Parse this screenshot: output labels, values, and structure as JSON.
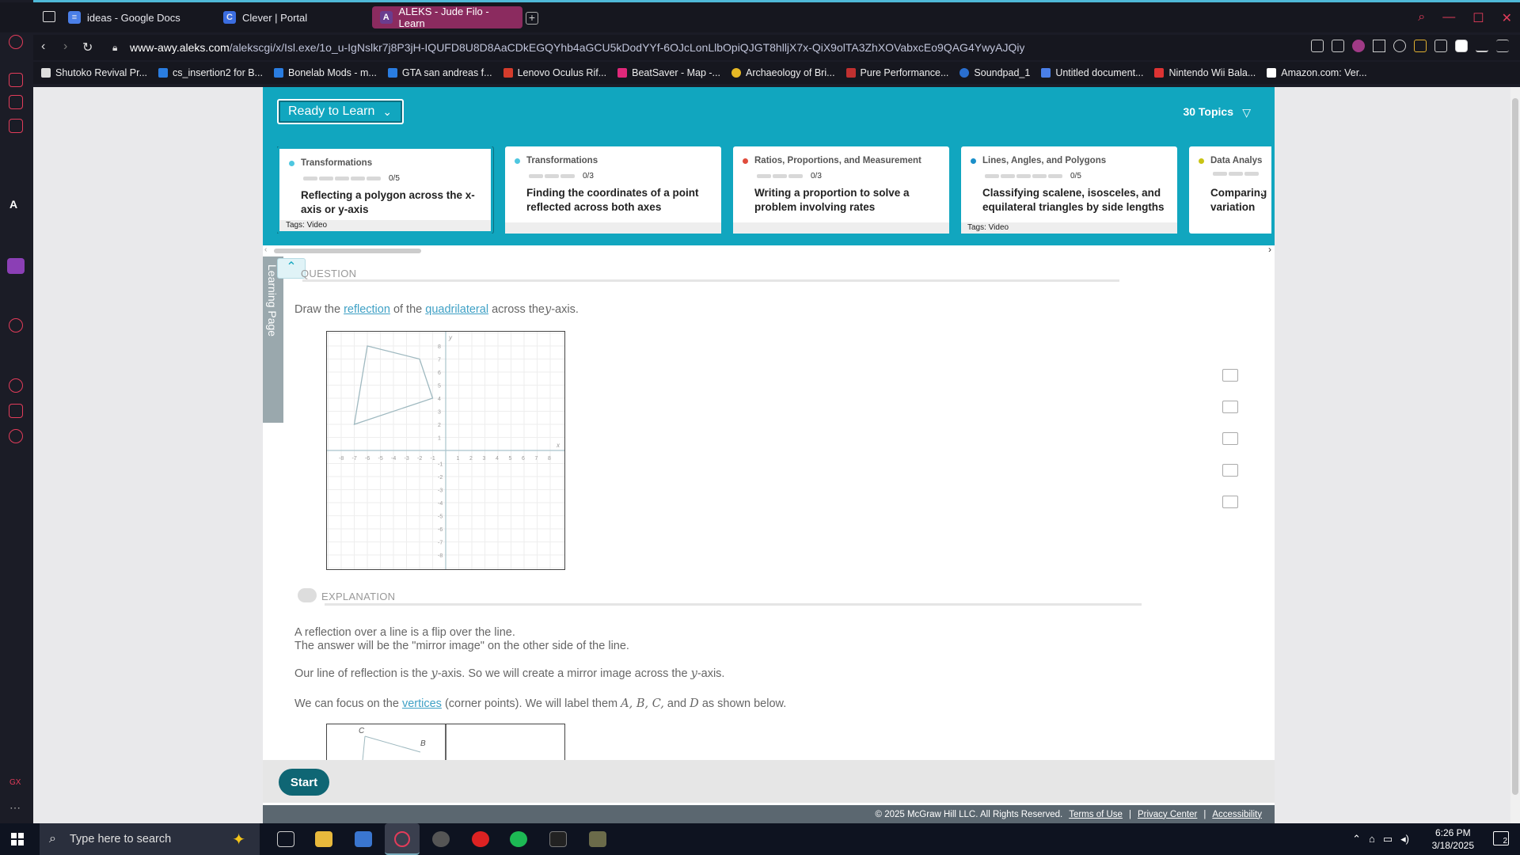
{
  "browser": {
    "tabs": [
      {
        "label": "ideas - Google Docs",
        "active": false
      },
      {
        "label": "Clever | Portal",
        "active": false
      },
      {
        "label": "ALEKS - Jude Filo - Learn",
        "active": true
      }
    ],
    "url_domain": "www-awy.aleks.com",
    "url_path": "/alekscgi/x/Isl.exe/1o_u-IgNslkr7j8P3jH-IQUFD8U8D8AaCDkEGQYhb4aGCU5kDodYYf-6OJcLonLlbOpiQJGT8hlljX7x-QiX9olTA3ZhXOVabxcEo9QAG4YwyAJQiyPR",
    "bookmarks": [
      "Shutoko Revival Pr...",
      "cs_insertion2 for B...",
      "Bonelab Mods - m...",
      "GTA san andreas f...",
      "Lenovo Oculus Rif...",
      "BeatSaver - Map -...",
      "Archaeology of Bri...",
      "Pure Performance...",
      "Soundpad_1",
      "Untitled document...",
      "Nintendo Wii Bala...",
      "Amazon.com: Ver..."
    ],
    "sidebar_label": "GX"
  },
  "header": {
    "ready_label": "Ready to Learn",
    "topics_label": "30 Topics"
  },
  "cards": [
    {
      "category": "Transformations",
      "color": "#4ec7e0",
      "progress": "0/5",
      "title": "Reflecting a polygon across the x-axis or y-axis",
      "tags": "Tags: Video"
    },
    {
      "category": "Transformations",
      "color": "#4ec7e0",
      "progress": "0/3",
      "title": "Finding the coordinates of a point reflected across both axes",
      "tags": ""
    },
    {
      "category": "Ratios, Proportions, and Measurement",
      "color": "#e04c3c",
      "progress": "0/3",
      "title": "Writing a proportion to solve a problem involving rates",
      "tags": ""
    },
    {
      "category": "Lines, Angles, and Polygons",
      "color": "#1a8fc9",
      "progress": "0/5",
      "title": "Classifying scalene, isosceles, and equilateral triangles by side lengths",
      "tags": "Tags: Video"
    },
    {
      "category": "Data Analys",
      "color": "#c9c414",
      "progress": "",
      "title": "Comparing variation",
      "tags": ""
    }
  ],
  "learning_page_label": "Learning Page",
  "question": {
    "heading": "QUESTION",
    "text_1": "Draw the",
    "link_1": "reflection",
    "text_2": "of the",
    "link_2": "quadrilateral",
    "text_3": "across the",
    "var": "y",
    "text_4": "-axis."
  },
  "explanation": {
    "heading": "EXPLANATION",
    "p1": "A reflection over a line is a flip over the line.",
    "p2": "The answer will be the \"mirror image\" on the other side of the line.",
    "p3a": "Our line of reflection is the",
    "p3b": "-axis. So we will create a mirror image across the",
    "p3c": "-axis.",
    "p4a": "We can focus on the",
    "p4link": "vertices",
    "p4b": "(corner points). We will label them",
    "p4vars": "A, B, C,",
    "p4c": "and",
    "p4d": "D",
    "p4e": "as shown below.",
    "label_c": "C",
    "label_b": "B"
  },
  "graph": {
    "x_ticks": [
      "-8",
      "-7",
      "-6",
      "-5",
      "-4",
      "-3",
      "-2",
      "-1",
      "1",
      "2",
      "3",
      "4",
      "5",
      "6",
      "7",
      "8"
    ],
    "y_ticks": [
      "8",
      "7",
      "6",
      "5",
      "4",
      "3",
      "2",
      "1",
      "-1",
      "-2",
      "-3",
      "-4",
      "-5",
      "-6",
      "-7",
      "-8"
    ],
    "x_label": "x",
    "y_label": "y",
    "quadrilateral": [
      [
        -6,
        8
      ],
      [
        -2,
        7
      ],
      [
        -1,
        4
      ],
      [
        -7,
        2
      ]
    ]
  },
  "footer": {
    "start_label": "Start",
    "copyright": "© 2025 McGraw Hill LLC. All Rights Reserved.",
    "terms": "Terms of Use",
    "privacy": "Privacy Center",
    "accessibility": "Accessibility"
  },
  "taskbar": {
    "search_placeholder": "Type here to search",
    "time": "6:26 PM",
    "date": "3/18/2025",
    "notif_count": "2"
  }
}
